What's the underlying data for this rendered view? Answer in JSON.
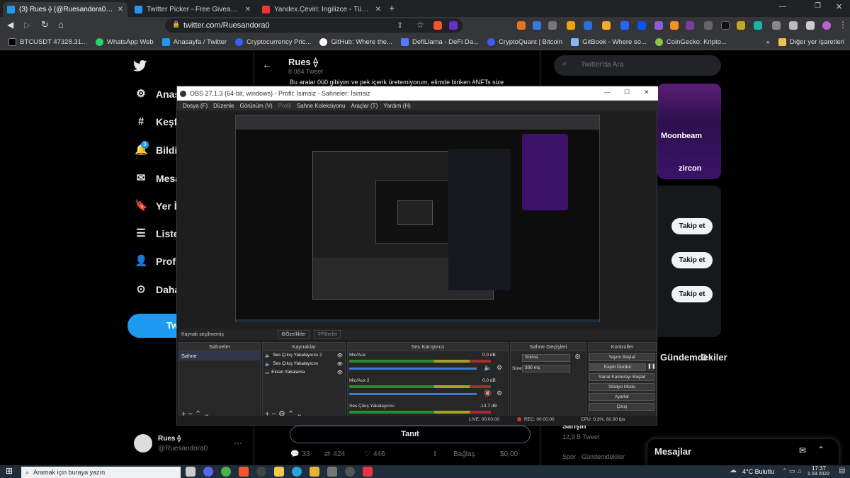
{
  "browser": {
    "tabs": [
      {
        "title": "(3) Rues ⟠ (@Ruesandora0) / Twit",
        "active": true
      },
      {
        "title": "Twitter Picker - Free Giveaway Picker",
        "active": false
      },
      {
        "title": "Yandex.Çeviri: İngilizce - Türkçe, Rusça",
        "active": false
      }
    ],
    "url": "twitter.com/Ruesandora0",
    "bookmarks": [
      "BTCUSDT 47328.31...",
      "WhatsApp Web",
      "Anasayfa / Twitter",
      "Cryptocurrency Pric...",
      "GitHub: Where the...",
      "DefiLlama - DeFi Da...",
      "CryptoQuant | Bitcoin",
      "GitBook - Where so...",
      "CoinGecko: Kripto..."
    ],
    "other_bookmarks": "Diğer yer işaretleri"
  },
  "twitter": {
    "nav": [
      "Anasayfa",
      "Keşfet",
      "Bildirimler",
      "Mesajlar",
      "Yer İşaretleri",
      "Listeler",
      "Profil",
      "Daha fazla"
    ],
    "notif_count": "3",
    "tweet_button": "Tweetle",
    "profile_name": "Rues ⟠",
    "profile_handle": "@Ruesandora0",
    "header_name": "Rues ⟠",
    "header_tweets": "8.084 Tweet",
    "tweet_text": "Bu aralar 0ü0 gibiyim ve pek içerik üretemiyorum, elimde biriken #NFTs size",
    "search_placeholder": "Twitter'da Ara",
    "follow_label": "Takip et",
    "trends_title": "Gündemdekiler",
    "trend_item": "Sarışın",
    "trend_count": "12,9 B Tweet",
    "trend_cat": "Spor · Gündemdekiler",
    "messages_label": "Mesajlar",
    "tweet_action": "Tanıt",
    "stats": {
      "replies": "33",
      "retweets": "424",
      "likes": "446",
      "share": "Bağlaş",
      "tip": "$0,00"
    },
    "promo": {
      "moonbeam": "Moonbeam",
      "zircon": "zircon"
    }
  },
  "obs": {
    "title": "OBS 27.1.3 (64-bit, windows) - Profil: İsimsiz - Sahneler: İsimsiz",
    "menu": [
      "Dosya (F)",
      "Düzenle",
      "Görünüm (V)",
      "Profil",
      "Sahne Koleksiyonu",
      "Araçlar (T)",
      "Yardım (H)"
    ],
    "source_hint": "Kaynak seçilmemiş",
    "props_label": "Özellikler",
    "filters_label": "Filtreler",
    "panels": {
      "scenes": "Sahneler",
      "sources": "Kaynaklar",
      "mixer": "Ses Karıştırıcı",
      "transitions": "Sahne Geçişleri",
      "controls": "Kontroller"
    },
    "scene_item": "Sahne",
    "sources": [
      "Ses Çıkış Yakalayıcısı 2",
      "Ses Çıkış Yakalayıcısı",
      "Ekran Yakalama"
    ],
    "mixer_channels": [
      {
        "name": "Mic/Aux",
        "db": "0.0 dB"
      },
      {
        "name": "Mic/Aux 2",
        "db": "0.0 dB"
      },
      {
        "name": "Ses Çıkış Yakalayıcısı",
        "db": "-14.7 dB"
      }
    ],
    "transition": "Solma",
    "duration_label": "Süre",
    "duration_value": "300 ms",
    "controls": [
      "Yayını Başlat",
      "Kaydı Durdur",
      "Sanal Kamerayı Başlat",
      "Stüdyo Modu",
      "Ayarlar",
      "Çıkış"
    ],
    "status": {
      "live": "LIVE: 00:00:00",
      "rec": "REC: 00:00:00",
      "cpu": "CPU: 0.3%, 60.00 fps"
    }
  },
  "taskbar": {
    "search": "Aramak için buraya yazın",
    "weather": "4°C Bulutlu",
    "time": "17:37",
    "date": "1.03.2022"
  },
  "colors": {
    "twitter_blue": "#1d9bf0",
    "obs_bg": "#1e1e1e",
    "chrome_bg": "#35363a",
    "rec_red": "#d33"
  }
}
